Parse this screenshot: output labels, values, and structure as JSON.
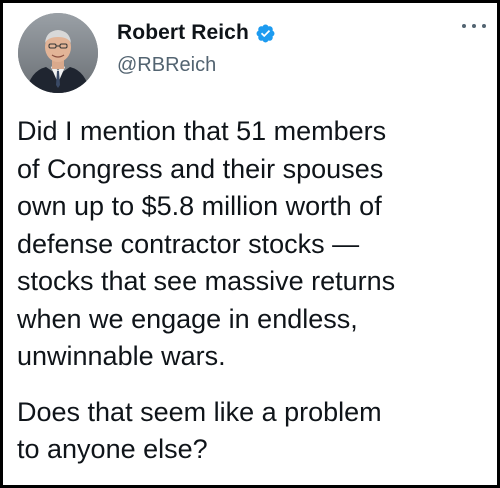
{
  "user": {
    "name": "Robert Reich",
    "handle": "@RBReich",
    "verified": true
  },
  "tweet": {
    "paragraph_1": "Did I mention that 51 members\nof Congress and their spouses\nown up to $5.8 million worth of\ndefense contractor stocks —\nstocks that see massive returns\nwhen we engage in endless,\nunwinnable wars.",
    "paragraph_2": "Does that seem like a problem\nto anyone else?"
  },
  "icons": {
    "verified": "verified-badge-icon",
    "more": "more-options-icon"
  },
  "colors": {
    "verified": "#1d9bf0",
    "text": "#0f1419",
    "secondary": "#536471"
  }
}
